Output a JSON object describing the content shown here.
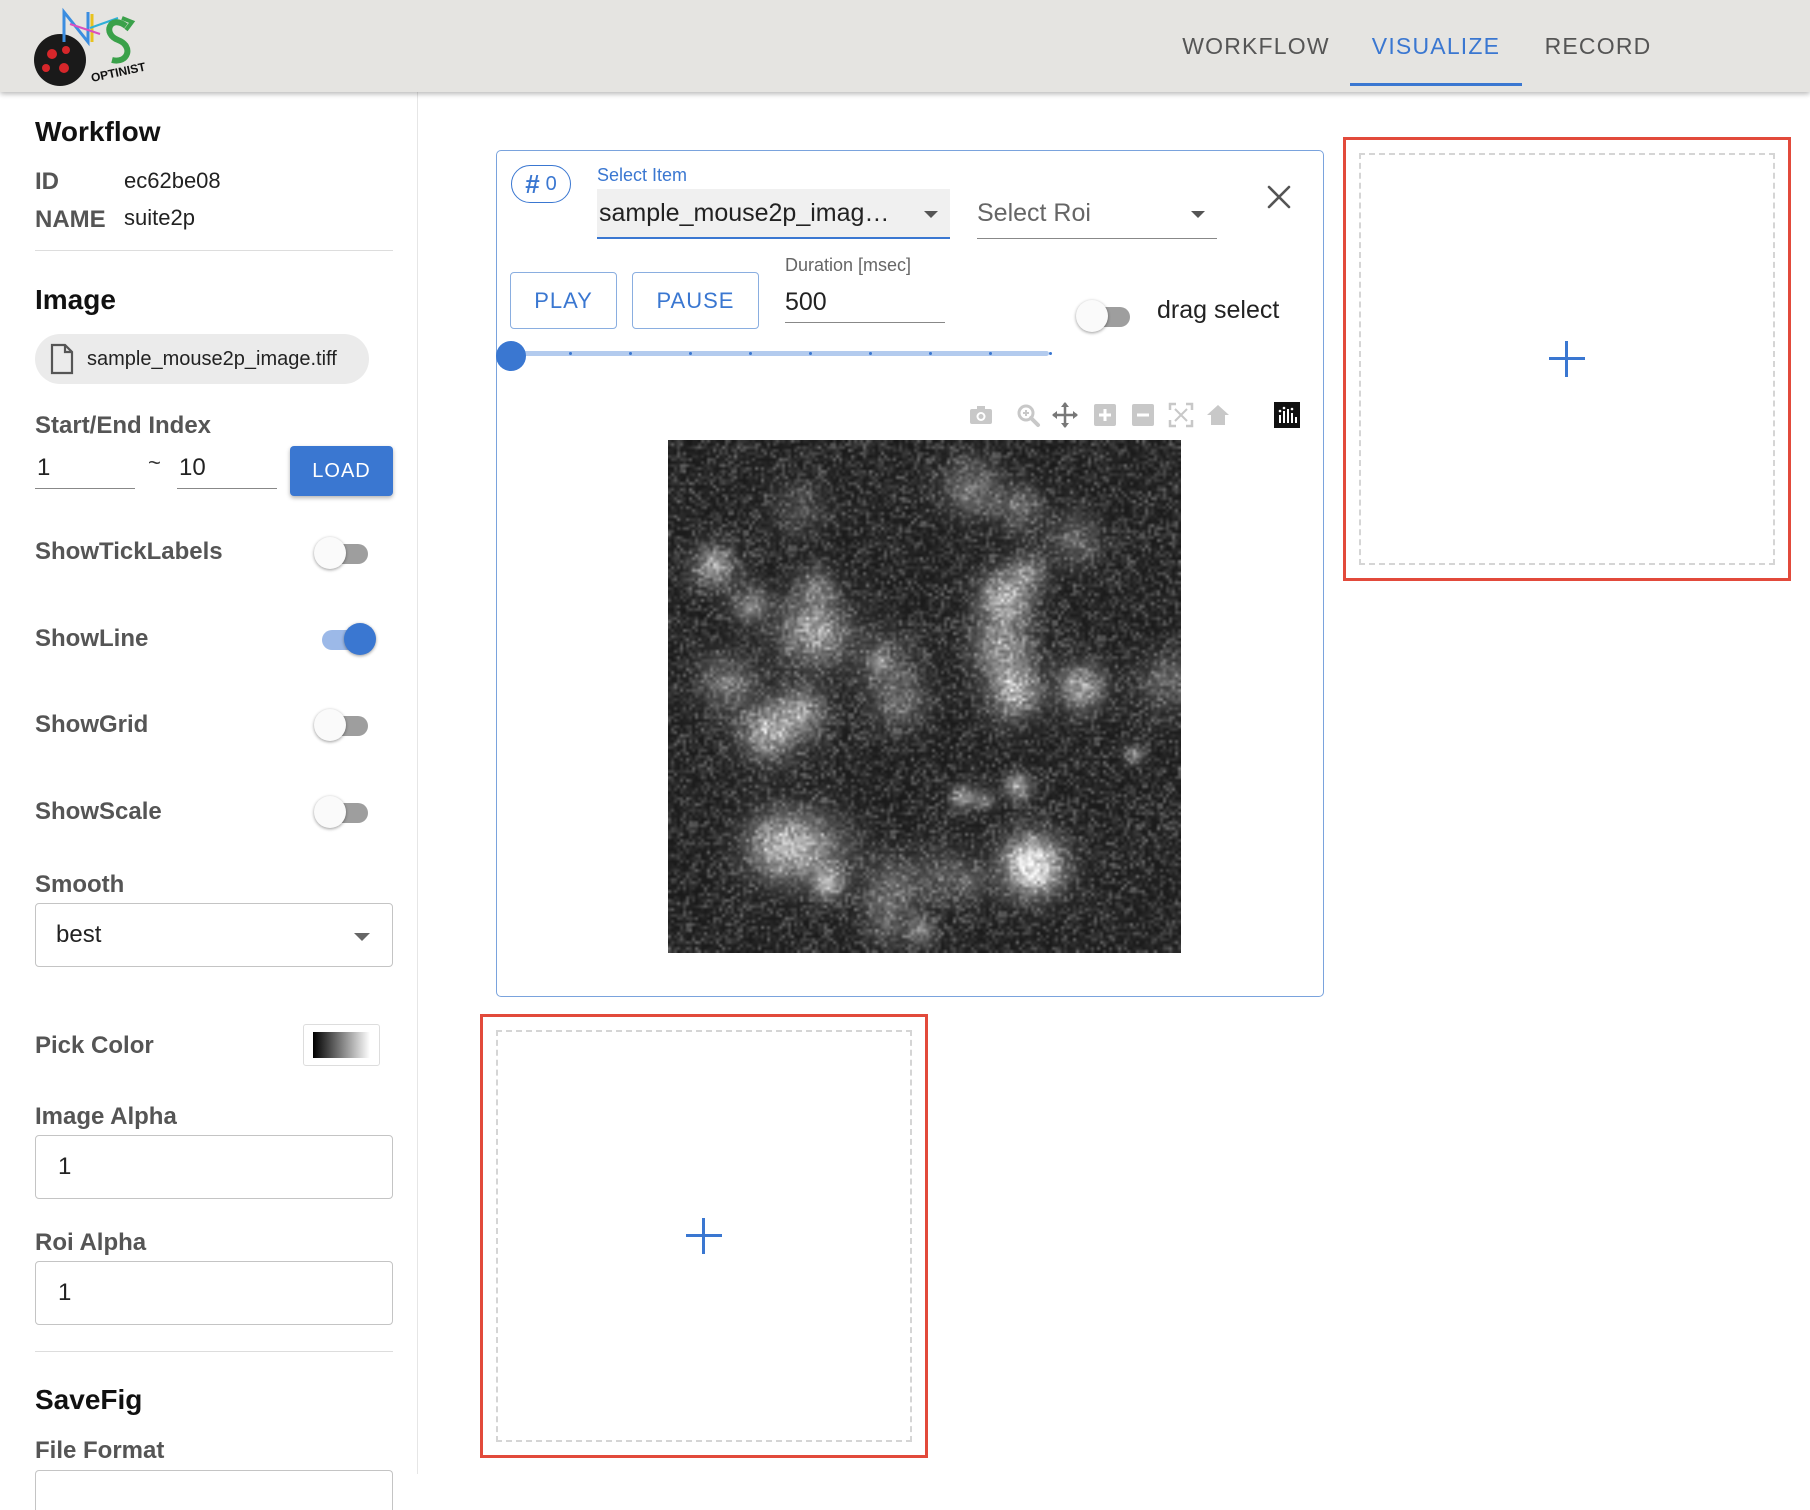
{
  "header": {
    "logo_text": "OPTINIST",
    "tabs": [
      {
        "label": "WORKFLOW",
        "active": false
      },
      {
        "label": "VISUALIZE",
        "active": true
      },
      {
        "label": "RECORD",
        "active": false
      }
    ],
    "accent_color": "#3a77d1"
  },
  "sidebar": {
    "workflow": {
      "title": "Workflow",
      "id_label": "ID",
      "id_value": "ec62be08",
      "name_label": "NAME",
      "name_value": "suite2p"
    },
    "image": {
      "title": "Image",
      "file_chip": "sample_mouse2p_image.tiff",
      "file_icon": "file-icon",
      "start_end_label": "Start/End Index",
      "start_value": "1",
      "tilde": "~",
      "end_value": "10",
      "load_label": "LOAD"
    },
    "toggles": [
      {
        "label": "ShowTickLabels",
        "on": false
      },
      {
        "label": "ShowLine",
        "on": true
      },
      {
        "label": "ShowGrid",
        "on": false
      },
      {
        "label": "ShowScale",
        "on": false
      }
    ],
    "smooth": {
      "label": "Smooth",
      "value": "best"
    },
    "pick_color": {
      "label": "Pick Color",
      "gradient": [
        "#000000",
        "#ffffff"
      ]
    },
    "image_alpha": {
      "label": "Image Alpha",
      "value": "1"
    },
    "roi_alpha": {
      "label": "Roi Alpha",
      "value": "1"
    },
    "savefig": {
      "title": "SaveFig",
      "file_format_label": "File Format"
    }
  },
  "card": {
    "index_chip": {
      "hash": "#",
      "value": "0"
    },
    "select_item": {
      "label": "Select Item",
      "value": "sample_mouse2p_imag…"
    },
    "select_roi": {
      "placeholder": "Select Roi"
    },
    "play_label": "PLAY",
    "pause_label": "PAUSE",
    "duration": {
      "label": "Duration [msec]",
      "value": "500"
    },
    "drag_select": {
      "label": "drag select",
      "on": false
    },
    "slider": {
      "value_index": 0,
      "marks": 10
    },
    "modebar_icons": [
      "camera-icon",
      "zoom-icon",
      "pan-icon",
      "zoom-in-icon",
      "zoom-out-icon",
      "autoscale-icon",
      "reset-axes-icon",
      "plotly-logo-icon"
    ]
  },
  "empty_slots": [
    {
      "name": "add-plot-slot-right",
      "icon": "plus-icon"
    },
    {
      "name": "add-plot-slot-bottom",
      "icon": "plus-icon"
    }
  ]
}
